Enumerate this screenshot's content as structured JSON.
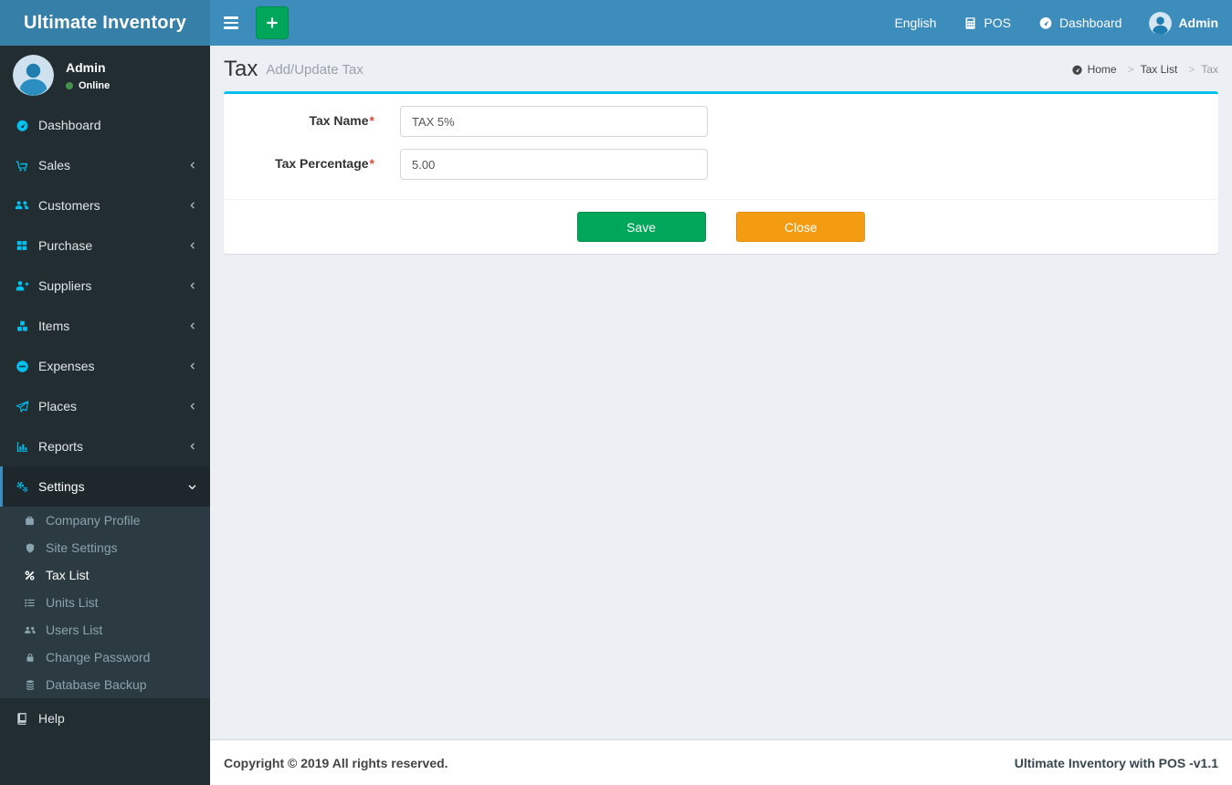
{
  "app": {
    "brand": "Ultimate Inventory",
    "footer": {
      "left": "Copyright © 2019 All rights reserved.",
      "right": "Ultimate Inventory with POS -v1.1"
    }
  },
  "header": {
    "nav": {
      "language": "English",
      "pos": "POS",
      "dashboard": "Dashboard",
      "user": "Admin"
    }
  },
  "sidebar": {
    "user": {
      "name": "Admin",
      "status": "Online"
    },
    "items": [
      {
        "label": "Dashboard",
        "icon": "tachometer-icon"
      },
      {
        "label": "Sales",
        "icon": "cart-icon"
      },
      {
        "label": "Customers",
        "icon": "users-icon"
      },
      {
        "label": "Purchase",
        "icon": "grid-icon"
      },
      {
        "label": "Suppliers",
        "icon": "user-plus-icon"
      },
      {
        "label": "Items",
        "icon": "cubes-icon"
      },
      {
        "label": "Expenses",
        "icon": "minus-circle-icon"
      },
      {
        "label": "Places",
        "icon": "paper-plane-icon"
      },
      {
        "label": "Reports",
        "icon": "bar-chart-icon"
      },
      {
        "label": "Settings",
        "icon": "gears-icon",
        "active": true
      }
    ],
    "settings_submenu": [
      {
        "label": "Company Profile",
        "icon": "briefcase-icon"
      },
      {
        "label": "Site Settings",
        "icon": "shield-icon"
      },
      {
        "label": "Tax List",
        "icon": "percent-icon",
        "active": true
      },
      {
        "label": "Units List",
        "icon": "list-icon"
      },
      {
        "label": "Users List",
        "icon": "users-icon"
      },
      {
        "label": "Change Password",
        "icon": "lock-icon"
      },
      {
        "label": "Database Backup",
        "icon": "database-icon"
      }
    ],
    "help": {
      "label": "Help",
      "icon": "book-icon"
    }
  },
  "page": {
    "title": "Tax",
    "subtitle": "Add/Update Tax",
    "breadcrumb": [
      {
        "label": "Home"
      },
      {
        "label": "Tax List"
      },
      {
        "label": "Tax"
      }
    ]
  },
  "form": {
    "fields": [
      {
        "label": "Tax Name",
        "required_mark": "*",
        "value": "TAX 5%"
      },
      {
        "label": "Tax Percentage",
        "required_mark": "*",
        "value": "5.00"
      }
    ],
    "buttons": {
      "save": "Save",
      "close": "Close"
    }
  },
  "colors": {
    "navbar_blue": "#3c8dbc",
    "logo_blue": "#367fa9",
    "sidebar_dark": "#222d32",
    "submenu_dark": "#2c3b41",
    "icon_cyan": "#00c0ef",
    "box_top_border_cyan": "#00c0ef",
    "save_green": "#00a65a",
    "close_orange": "#f39c12",
    "online_green": "#45914d",
    "content_bg": "#ecf0f5",
    "required_red": "#dd4b39"
  }
}
